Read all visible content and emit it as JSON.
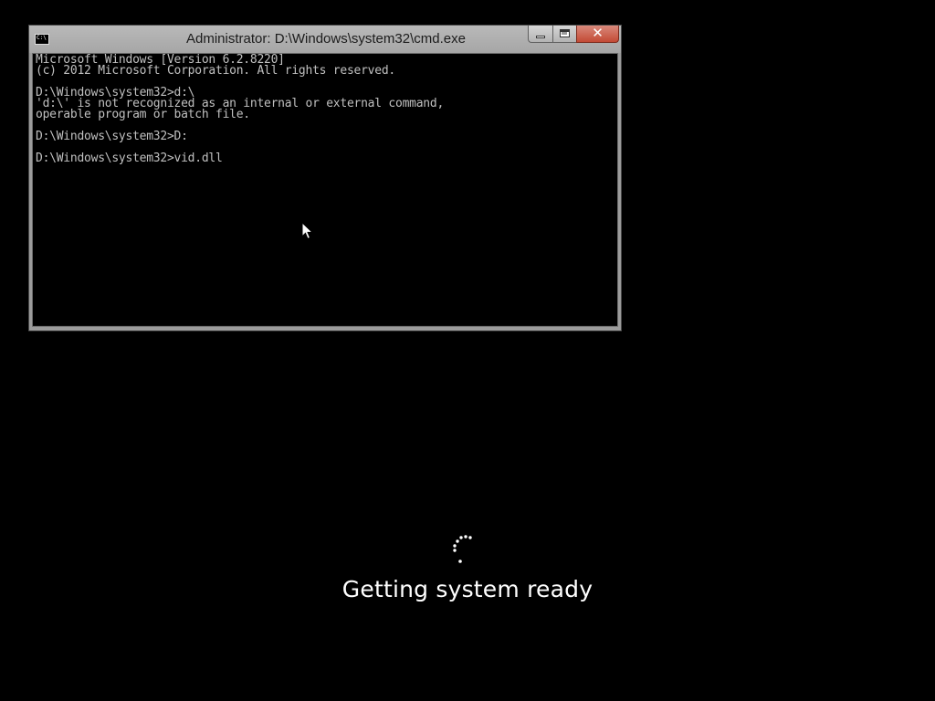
{
  "window": {
    "title": "Administrator: D:\\Windows\\system32\\cmd.exe",
    "icon": "cmd-icon",
    "icon_text": "C:\\",
    "buttons": {
      "minimize": "minimize-icon",
      "maximize": "maximize-icon",
      "close": "✕"
    }
  },
  "console": {
    "lines": [
      "Microsoft Windows [Version 6.2.8220]",
      "(c) 2012 Microsoft Corporation. All rights reserved.",
      "",
      "D:\\Windows\\system32>d:\\",
      "'d:\\' is not recognized as an internal or external command,",
      "operable program or batch file.",
      "",
      "D:\\Windows\\system32>D:",
      "",
      "D:\\Windows\\system32>vid.dll"
    ],
    "text_color": "#c0c0c0",
    "background": "#000000"
  },
  "boot_status": {
    "text": "Getting system ready",
    "spinner": "loading-spinner-icon",
    "color": "#ffffff"
  },
  "pointer": "mouse-pointer-icon"
}
